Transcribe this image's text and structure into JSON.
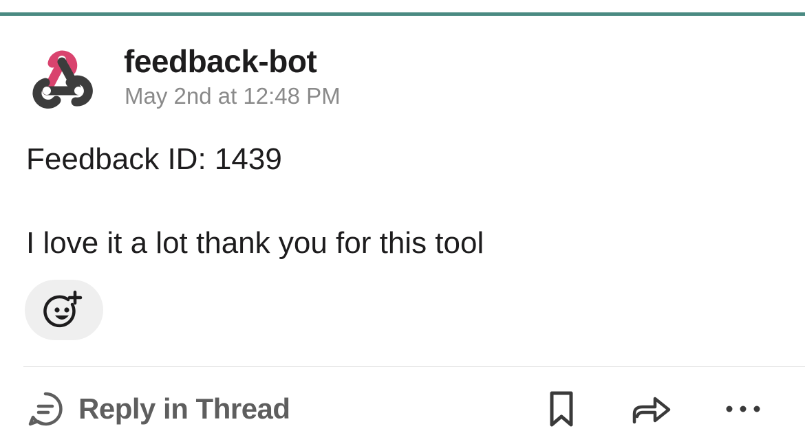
{
  "message": {
    "author": "feedback-bot",
    "timestamp": "May 2nd at 12:48 PM",
    "lines": [
      "Feedback ID: 1439",
      "I love it a lot thank you for this tool"
    ],
    "avatar_icon": "webhook-icon"
  },
  "reactions": {
    "add_reaction_icon": "add-reaction-icon"
  },
  "footer": {
    "reply_label": "Reply in Thread",
    "reply_icon": "comment-icon",
    "actions": [
      "bookmark-icon",
      "share-arrow-icon",
      "more-icon"
    ]
  },
  "colors": {
    "accent_bar": "#4a8a82",
    "webhook_pink": "#d9436e",
    "webhook_dark": "#3c3c3c",
    "timestamp_gray": "#8a8a8a",
    "reply_gray": "#5e5e5e"
  }
}
